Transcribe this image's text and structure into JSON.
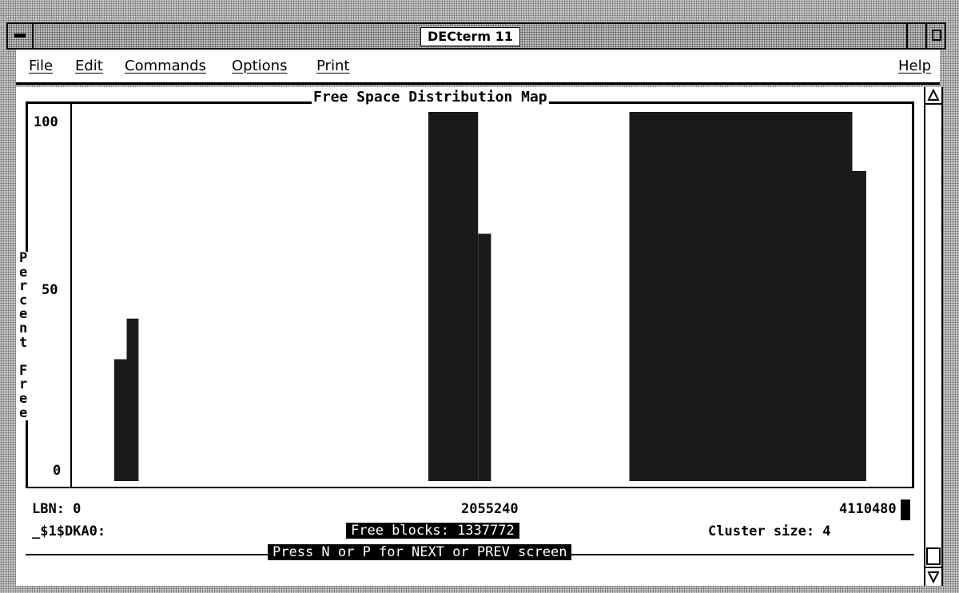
{
  "window": {
    "title": "DECterm 11"
  },
  "menubar": {
    "items": [
      "File",
      "Edit",
      "Commands",
      "Options",
      "Print"
    ],
    "help": "Help"
  },
  "map": {
    "title": "Free Space Distribution Map",
    "y_label_letters": [
      "P",
      "e",
      "r",
      "c",
      "e",
      "n",
      "t",
      "",
      "F",
      "r",
      "e",
      "e"
    ],
    "y_ticks": [
      "100",
      "50",
      "0"
    ],
    "lbn_label": "LBN: 0",
    "lbn_mid": "2055240",
    "lbn_end": "4110480",
    "device": "_$1$DKA0:",
    "free_blocks": "Free blocks: 1337772",
    "cluster_size": "Cluster size: 4",
    "prompt": "Press N or P for NEXT or PREV screen"
  },
  "chart_data": {
    "type": "bar",
    "title": "Free Space Distribution Map",
    "ylabel": "Percent Free",
    "xlabel": "LBN",
    "x_ticks": [
      0,
      2055240,
      4110480
    ],
    "ylim": [
      0,
      100
    ],
    "xlim": [
      0,
      4110480
    ],
    "bars": [
      {
        "start": 212000,
        "end": 275000,
        "value": 33
      },
      {
        "start": 275000,
        "end": 335000,
        "value": 44
      },
      {
        "start": 1790000,
        "end": 2040000,
        "value": 100
      },
      {
        "start": 2040000,
        "end": 2105000,
        "value": 67
      },
      {
        "start": 2800000,
        "end": 3920000,
        "value": 100
      },
      {
        "start": 3920000,
        "end": 3990000,
        "value": 84
      }
    ]
  }
}
